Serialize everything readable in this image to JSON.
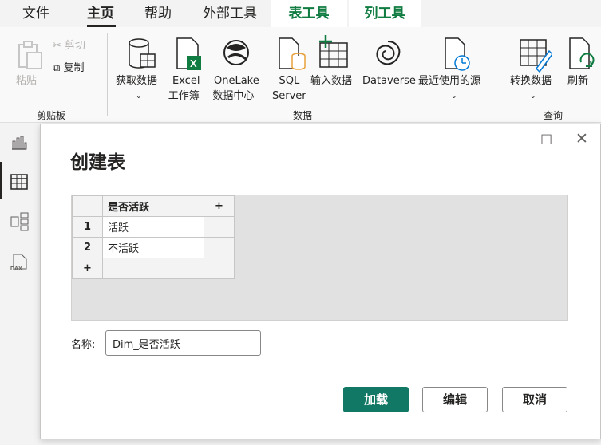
{
  "menu": {
    "tabs": [
      {
        "label": "文件"
      },
      {
        "label": "主页"
      },
      {
        "label": "帮助"
      },
      {
        "label": "外部工具"
      },
      {
        "label": "表工具"
      },
      {
        "label": "列工具"
      }
    ],
    "active_tab": "主页"
  },
  "ribbon": {
    "clipboard": {
      "paste": "粘贴",
      "cut": "剪切",
      "copy": "复制",
      "group_label": "剪贴板"
    },
    "data": {
      "get_data": "获取数据",
      "excel_line1": "Excel",
      "excel_line2": "工作簿",
      "onelake_line1": "OneLake",
      "onelake_line2": "数据中心",
      "sql_line1": "SQL",
      "sql_line2": "Server",
      "enter_data": "输入数据",
      "dataverse": "Dataverse",
      "recent_sources": "最近使用的源",
      "group_label": "数据"
    },
    "queries": {
      "transform": "转换数据",
      "refresh": "刷新",
      "group_label": "查询"
    }
  },
  "dialog": {
    "title": "创建表",
    "table": {
      "column_header": "是否活跃",
      "add_column": "+",
      "rows": [
        {
          "num": "1",
          "value": "活跃"
        },
        {
          "num": "2",
          "value": "不活跃"
        }
      ],
      "add_row": "+"
    },
    "name_label": "名称:",
    "name_value": "Dim_是否活跃",
    "buttons": {
      "load": "加载",
      "edit": "编辑",
      "cancel": "取消"
    }
  },
  "colors": {
    "accent": "#117865",
    "context_tab": "#107c41",
    "excel_green": "#107c41",
    "sql_orange": "#e8a23b"
  }
}
